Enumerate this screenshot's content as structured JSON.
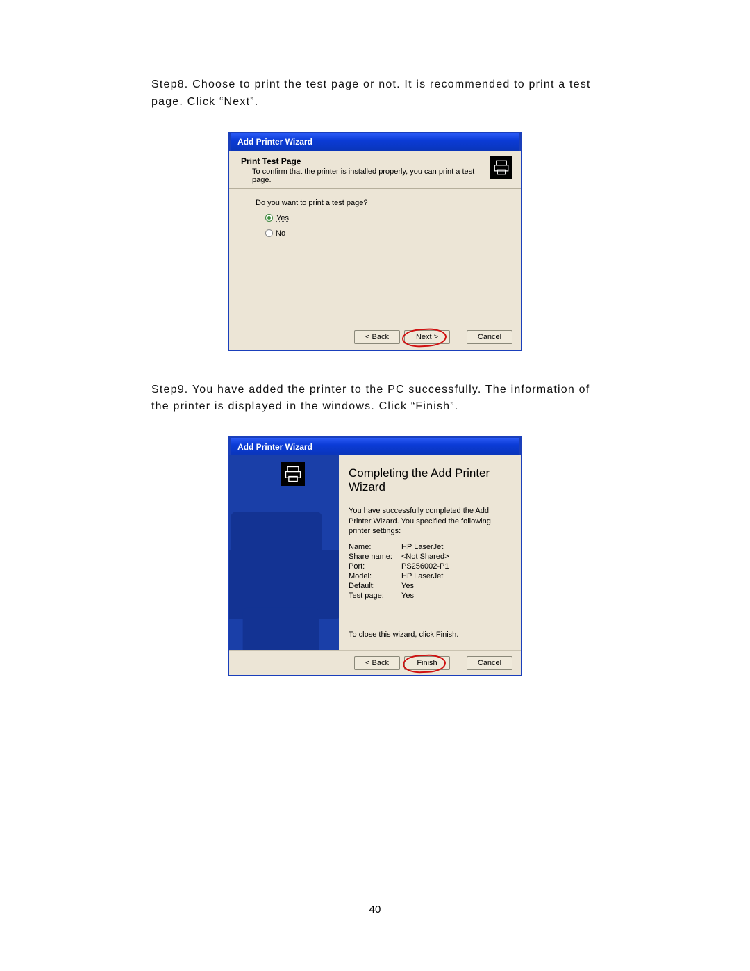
{
  "steps": {
    "step8": "Step8.   Choose to print the test page or not. It is recommended to print a test page. Click “Next”.",
    "step9": "Step9.   You have added the printer to the PC successfully. The information of the printer is displayed in the windows. Click “Finish”."
  },
  "wizard1": {
    "title": "Add Printer Wizard",
    "head_title": "Print Test Page",
    "head_sub": "To confirm that the printer is installed properly, you can print a test page.",
    "question": "Do you want to print a test page?",
    "yes": "Yes",
    "no": "No",
    "back": "< Back",
    "next": "Next >",
    "cancel": "Cancel"
  },
  "wizard2": {
    "title": "Add Printer Wizard",
    "heading": "Completing the Add Printer Wizard",
    "sub1": "You have successfully completed the Add Printer Wizard. You specified the following printer settings:",
    "rows": {
      "name_k": "Name:",
      "name_v": "HP LaserJet",
      "share_k": "Share name:",
      "share_v": "<Not Shared>",
      "port_k": "Port:",
      "port_v": "PS256002-P1",
      "model_k": "Model:",
      "model_v": "HP LaserJet",
      "default_k": "Default:",
      "default_v": "Yes",
      "test_k": "Test page:",
      "test_v": "Yes"
    },
    "close_text": "To close this wizard, click Finish.",
    "back": "< Back",
    "finish": "Finish",
    "cancel": "Cancel"
  },
  "page_number": "40"
}
